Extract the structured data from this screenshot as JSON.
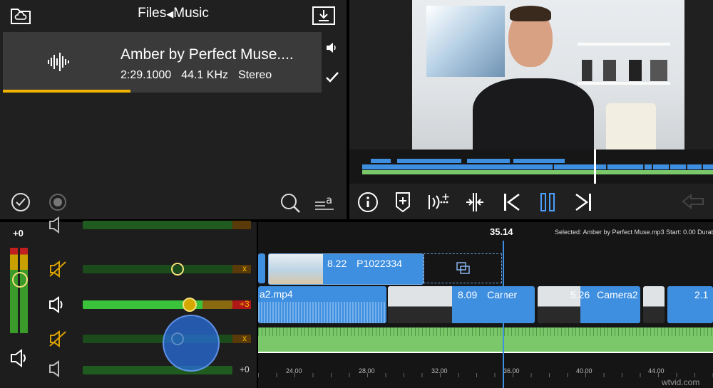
{
  "browser": {
    "breadcrumb_root": "Files",
    "breadcrumb_sep": "◀",
    "breadcrumb_current": "Music",
    "file": {
      "title": "Amber by Perfect Muse....",
      "duration": "2:29.1000",
      "sample_rate": "44.1 KHz",
      "channels": "Stereo",
      "preview_progress": 0.4
    }
  },
  "timeline": {
    "playhead_time": "35.14",
    "selection_info": "Selected: Amber by Perfect Muse.mp3 Start: 0.00 Duratio",
    "clips": {
      "top_clip_label": "8.22",
      "top_clip_name": "P1022334",
      "main_clip1_name": "a2.mp4",
      "main_clip2_label": "8.09",
      "main_clip2_name": "Camer",
      "main_clip3_label": "5.26",
      "main_clip3_name": "Camera2",
      "main_clip4_label": "2.1"
    },
    "ruler": [
      "24.00",
      "28.00",
      "32.00",
      "36.00",
      "40.00",
      "44.00"
    ]
  },
  "mixer": {
    "master_gain": "+0",
    "rows": [
      {
        "value": "x"
      },
      {
        "value": "+3"
      },
      {
        "value": "x"
      },
      {
        "value": "+0"
      }
    ]
  },
  "watermark": "wtvid.com",
  "colors": {
    "accent_blue": "#4a9fff",
    "clip_blue": "#3f8fe0",
    "audio_green": "#7ac86a",
    "progress_yellow": "#f0b400"
  }
}
